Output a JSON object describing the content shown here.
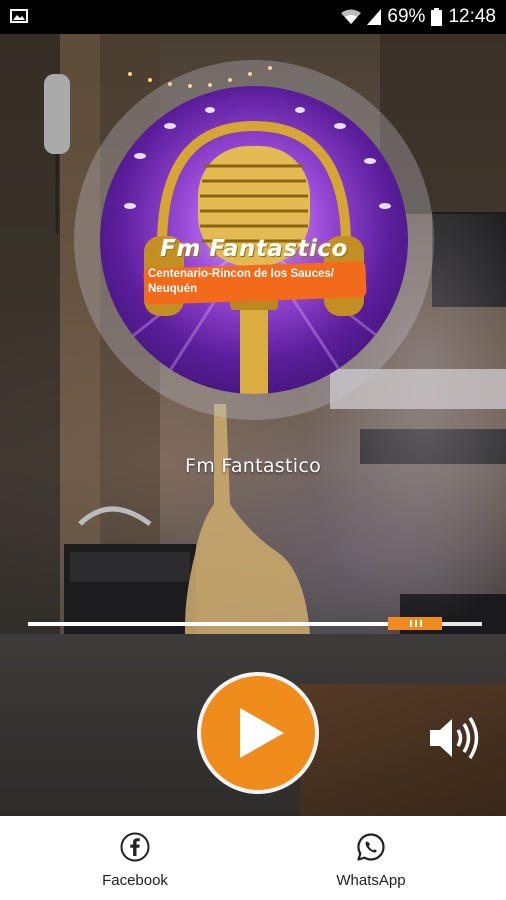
{
  "status_bar": {
    "battery": "69%",
    "time": "12:48"
  },
  "logo": {
    "brand": "Fm Fantastico",
    "subtitle_line1": "Centenario-Rincon de los Sauces/",
    "subtitle_line2": "Neuquén"
  },
  "player": {
    "station_title": "Fm Fantastico",
    "progress": 0.83
  },
  "bottom_nav": {
    "facebook_label": "Facebook",
    "whatsapp_label": "WhatsApp"
  },
  "colors": {
    "accent": "#f08c1c"
  }
}
